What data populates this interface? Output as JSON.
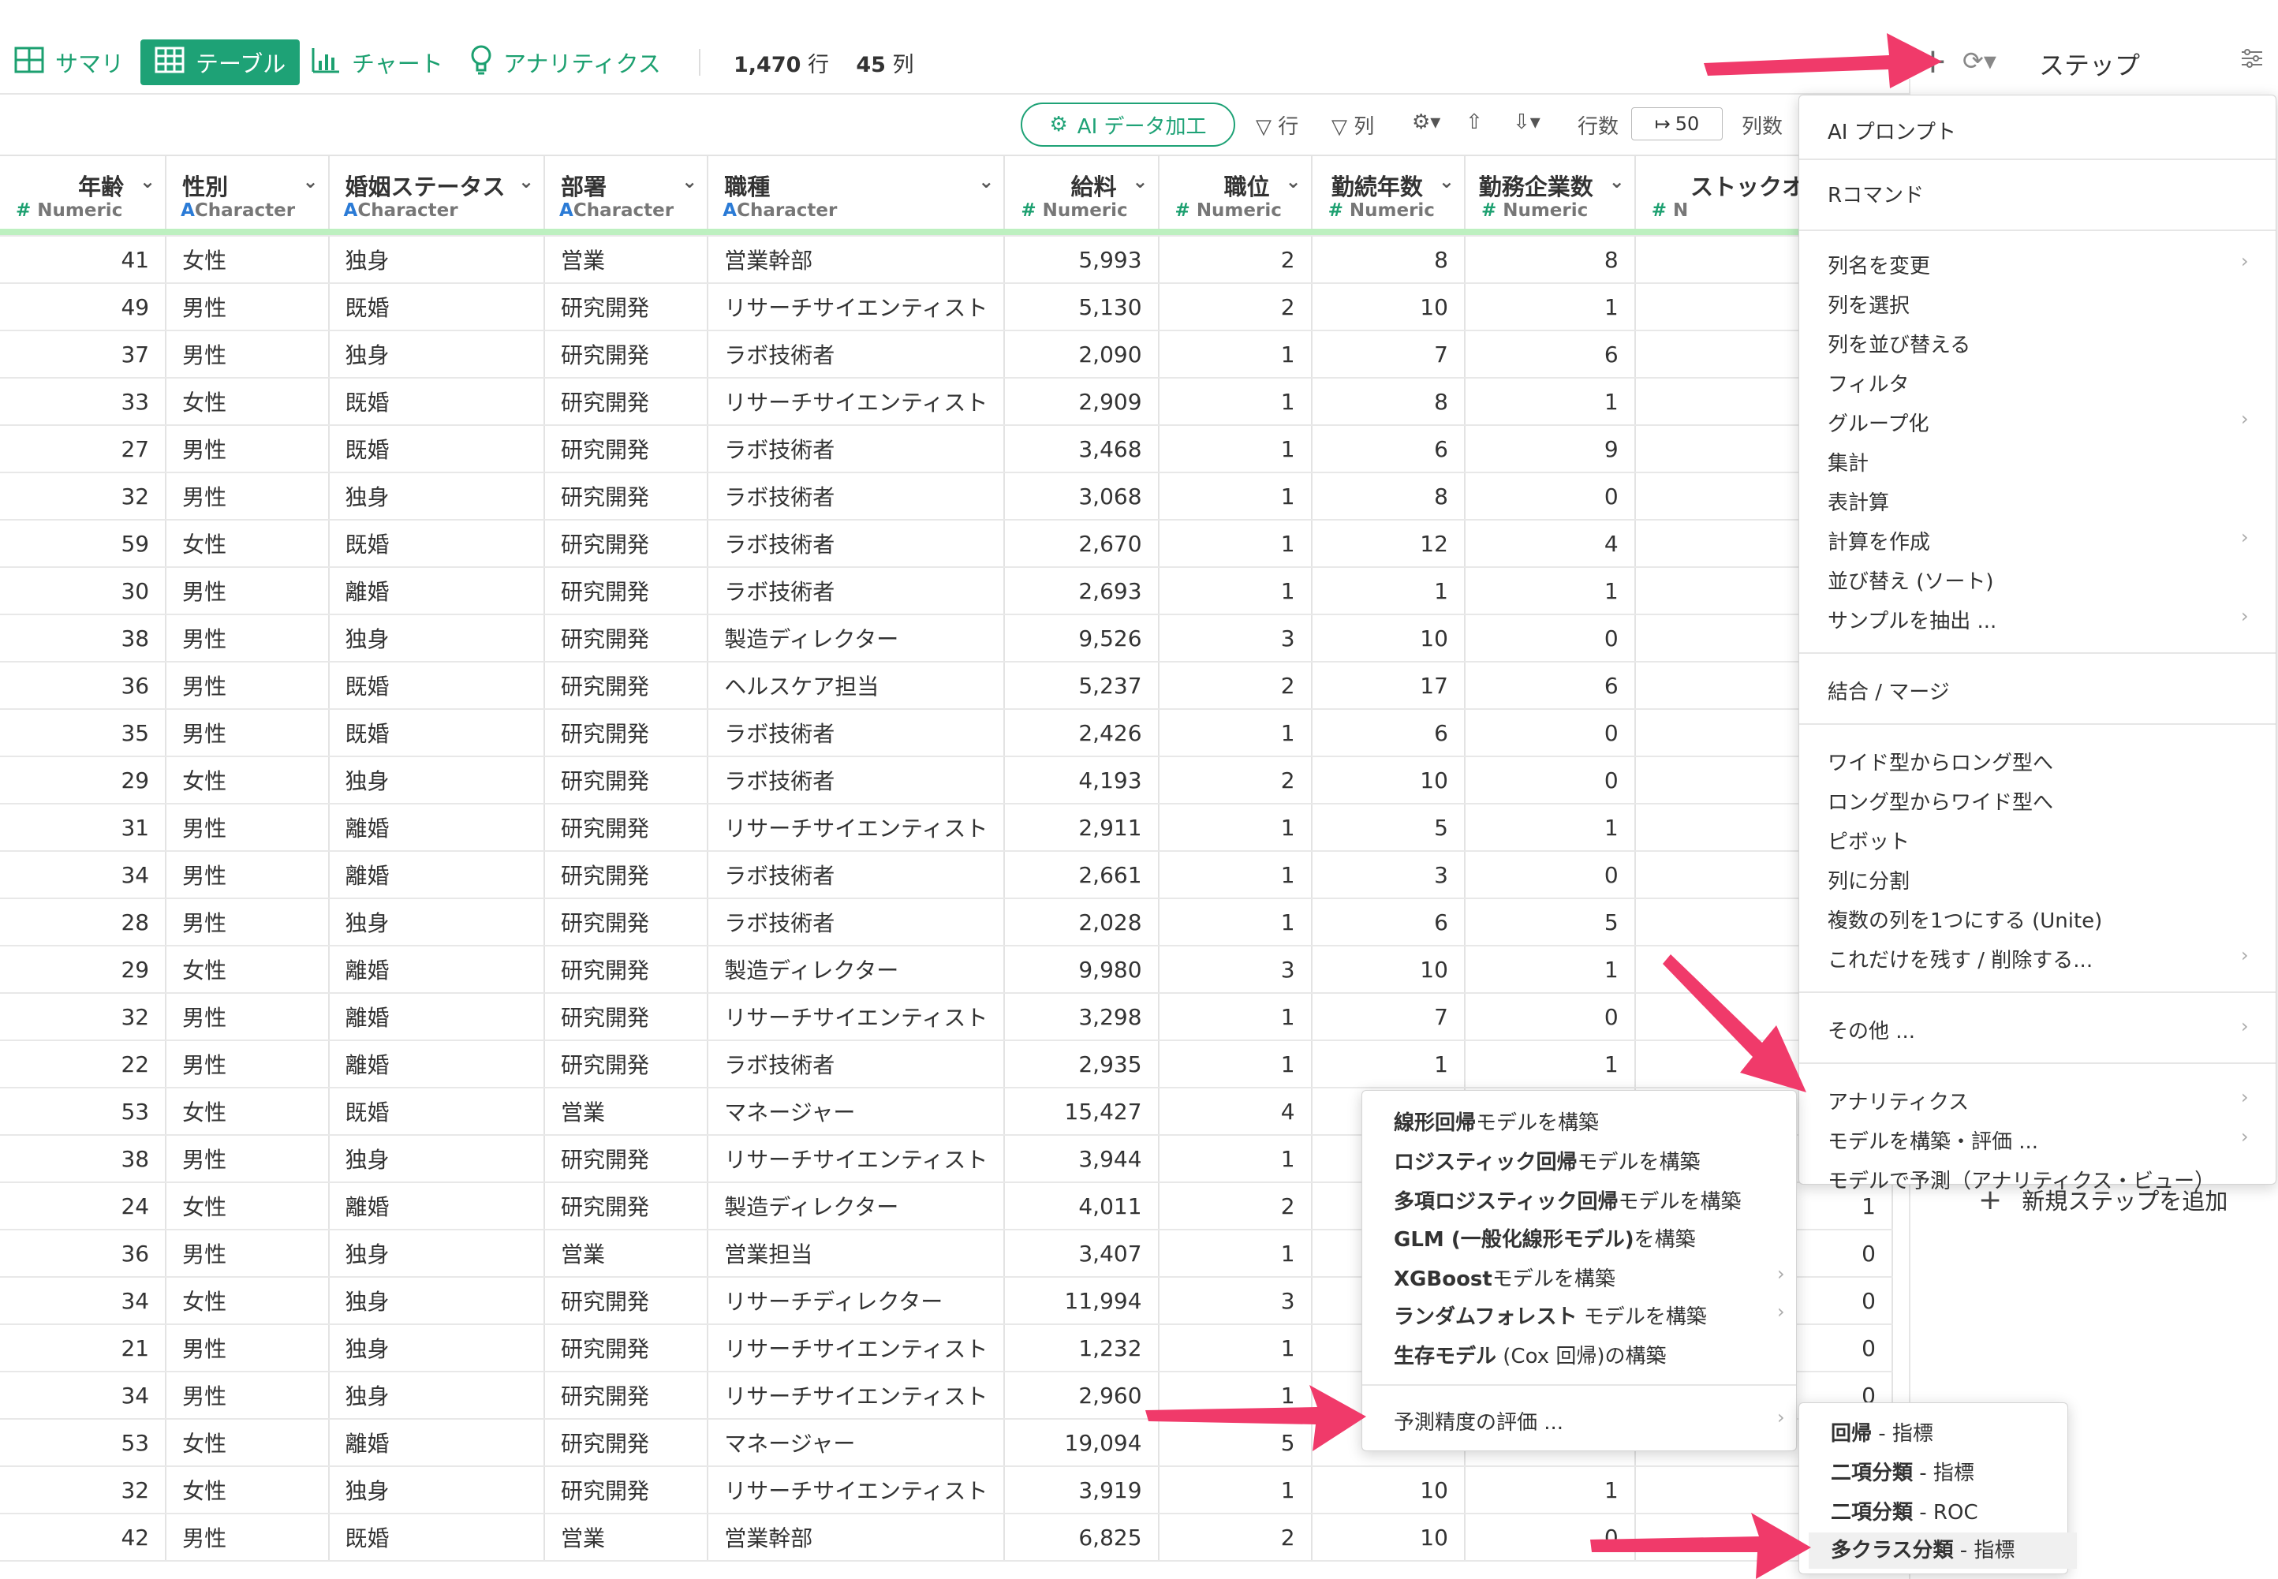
{
  "tabs": [
    {
      "label": "サマリ",
      "icon": "grid-icon"
    },
    {
      "label": "テーブル",
      "icon": "table-icon"
    },
    {
      "label": "チャート",
      "icon": "bar-chart-icon"
    },
    {
      "label": "アナリティクス",
      "icon": "lightbulb-icon"
    }
  ],
  "counts": {
    "rows": "1,470",
    "rows_unit": "行",
    "cols": "45",
    "cols_unit": "列"
  },
  "right_header": {
    "step_label": "ステップ"
  },
  "toolbar": {
    "ai_button": "AI データ加工",
    "row_filter": "行",
    "col_filter": "列",
    "rows_label": "行数",
    "rows_value": "50",
    "cols_label": "列数"
  },
  "columns": [
    {
      "name": "年齢",
      "type": "Numeric"
    },
    {
      "name": "性別",
      "type": "Character"
    },
    {
      "name": "婚姻ステータス",
      "type": "Character"
    },
    {
      "name": "部署",
      "type": "Character"
    },
    {
      "name": "職種",
      "type": "Character"
    },
    {
      "name": "給料",
      "type": "Numeric"
    },
    {
      "name": "職位",
      "type": "Numeric"
    },
    {
      "name": "勤続年数",
      "type": "Numeric"
    },
    {
      "name": "勤務企業数",
      "type": "Numeric"
    },
    {
      "name": "ストックオプシ",
      "type": "N"
    }
  ],
  "rows": [
    [
      "41",
      "女性",
      "独身",
      "営業",
      "営業幹部",
      "5,993",
      "2",
      "8",
      "8",
      ""
    ],
    [
      "49",
      "男性",
      "既婚",
      "研究開発",
      "リサーチサイエンティスト",
      "5,130",
      "2",
      "10",
      "1",
      ""
    ],
    [
      "37",
      "男性",
      "独身",
      "研究開発",
      "ラボ技術者",
      "2,090",
      "1",
      "7",
      "6",
      ""
    ],
    [
      "33",
      "女性",
      "既婚",
      "研究開発",
      "リサーチサイエンティスト",
      "2,909",
      "1",
      "8",
      "1",
      ""
    ],
    [
      "27",
      "男性",
      "既婚",
      "研究開発",
      "ラボ技術者",
      "3,468",
      "1",
      "6",
      "9",
      ""
    ],
    [
      "32",
      "男性",
      "独身",
      "研究開発",
      "ラボ技術者",
      "3,068",
      "1",
      "8",
      "0",
      ""
    ],
    [
      "59",
      "女性",
      "既婚",
      "研究開発",
      "ラボ技術者",
      "2,670",
      "1",
      "12",
      "4",
      ""
    ],
    [
      "30",
      "男性",
      "離婚",
      "研究開発",
      "ラボ技術者",
      "2,693",
      "1",
      "1",
      "1",
      ""
    ],
    [
      "38",
      "男性",
      "独身",
      "研究開発",
      "製造ディレクター",
      "9,526",
      "3",
      "10",
      "0",
      ""
    ],
    [
      "36",
      "男性",
      "既婚",
      "研究開発",
      "ヘルスケア担当",
      "5,237",
      "2",
      "17",
      "6",
      ""
    ],
    [
      "35",
      "男性",
      "既婚",
      "研究開発",
      "ラボ技術者",
      "2,426",
      "1",
      "6",
      "0",
      ""
    ],
    [
      "29",
      "女性",
      "独身",
      "研究開発",
      "ラボ技術者",
      "4,193",
      "2",
      "10",
      "0",
      ""
    ],
    [
      "31",
      "男性",
      "離婚",
      "研究開発",
      "リサーチサイエンティスト",
      "2,911",
      "1",
      "5",
      "1",
      ""
    ],
    [
      "34",
      "男性",
      "離婚",
      "研究開発",
      "ラボ技術者",
      "2,661",
      "1",
      "3",
      "0",
      ""
    ],
    [
      "28",
      "男性",
      "独身",
      "研究開発",
      "ラボ技術者",
      "2,028",
      "1",
      "6",
      "5",
      ""
    ],
    [
      "29",
      "女性",
      "離婚",
      "研究開発",
      "製造ディレクター",
      "9,980",
      "3",
      "10",
      "1",
      ""
    ],
    [
      "32",
      "男性",
      "離婚",
      "研究開発",
      "リサーチサイエンティスト",
      "3,298",
      "1",
      "7",
      "0",
      ""
    ],
    [
      "22",
      "男性",
      "離婚",
      "研究開発",
      "ラボ技術者",
      "2,935",
      "1",
      "1",
      "1",
      ""
    ],
    [
      "53",
      "女性",
      "既婚",
      "営業",
      "マネージャー",
      "15,427",
      "4",
      "",
      "",
      ""
    ],
    [
      "38",
      "男性",
      "独身",
      "研究開発",
      "リサーチサイエンティスト",
      "3,944",
      "1",
      "",
      "",
      ""
    ],
    [
      "24",
      "女性",
      "離婚",
      "研究開発",
      "製造ディレクター",
      "4,011",
      "2",
      "",
      "",
      "1"
    ],
    [
      "36",
      "男性",
      "独身",
      "営業",
      "営業担当",
      "3,407",
      "1",
      "",
      "",
      "0"
    ],
    [
      "34",
      "女性",
      "独身",
      "研究開発",
      "リサーチディレクター",
      "11,994",
      "3",
      "",
      "",
      "0"
    ],
    [
      "21",
      "男性",
      "独身",
      "研究開発",
      "リサーチサイエンティスト",
      "1,232",
      "1",
      "",
      "",
      "0"
    ],
    [
      "34",
      "男性",
      "独身",
      "研究開発",
      "リサーチサイエンティスト",
      "2,960",
      "1",
      "",
      "",
      "0"
    ],
    [
      "53",
      "女性",
      "離婚",
      "研究開発",
      "マネージャー",
      "19,094",
      "5",
      "",
      "",
      ""
    ],
    [
      "32",
      "女性",
      "独身",
      "研究開発",
      "リサーチサイエンティスト",
      "3,919",
      "1",
      "10",
      "1",
      ""
    ],
    [
      "42",
      "男性",
      "既婚",
      "営業",
      "営業幹部",
      "6,825",
      "2",
      "10",
      "0",
      ""
    ]
  ],
  "main_menu": [
    {
      "label": "AI プロンプト",
      "arrow": false
    },
    {
      "label": "Rコマンド",
      "arrow": false
    },
    {
      "label": "列名を変更",
      "arrow": true
    },
    {
      "label": "列を選択",
      "arrow": false
    },
    {
      "label": "列を並び替える",
      "arrow": false
    },
    {
      "label": "フィルタ",
      "arrow": false
    },
    {
      "label": "グループ化",
      "arrow": true
    },
    {
      "label": "集計",
      "arrow": false
    },
    {
      "label": "表計算",
      "arrow": false
    },
    {
      "label": "計算を作成",
      "arrow": true
    },
    {
      "label": "並び替え (ソート)",
      "arrow": false
    },
    {
      "label": "サンプルを抽出 ...",
      "arrow": true
    },
    {
      "label": "結合 / マージ",
      "arrow": false
    },
    {
      "label": "ワイド型からロング型へ",
      "arrow": false
    },
    {
      "label": "ロング型からワイド型へ",
      "arrow": false
    },
    {
      "label": "ピボット",
      "arrow": false
    },
    {
      "label": "列に分割",
      "arrow": false
    },
    {
      "label": "複数の列を1つにする (Unite)",
      "arrow": false
    },
    {
      "label": "これだけを残す / 削除する...",
      "arrow": true
    },
    {
      "label": "その他 ...",
      "arrow": true
    },
    {
      "label": "アナリティクス",
      "arrow": true
    },
    {
      "label": "モデルを構築・評価 ...",
      "arrow": true
    },
    {
      "label": "モデルで予測（アナリティクス・ビュー）",
      "arrow": false
    }
  ],
  "model_menu": [
    {
      "bold": "線形回帰",
      "rest": "モデルを構築",
      "arrow": false
    },
    {
      "bold": "ロジスティック回帰",
      "rest": "モデルを構築",
      "arrow": false
    },
    {
      "bold": "多項ロジスティック回帰",
      "rest": "モデルを構築",
      "arrow": false
    },
    {
      "bold": "GLM (一般化線形モデル)",
      "rest": "を構築",
      "arrow": false
    },
    {
      "bold": "XGBoost",
      "rest": "モデルを構築",
      "arrow": true
    },
    {
      "bold": "ランダムフォレスト",
      "rest": " モデルを構築",
      "arrow": true
    },
    {
      "bold": "生存モデル",
      "rest": " (Cox 回帰)の構築",
      "arrow": false
    },
    {
      "bold": "",
      "rest": "予測精度の評価 ...",
      "arrow": true
    }
  ],
  "eval_menu": [
    {
      "bold": "回帰",
      "rest": " - 指標"
    },
    {
      "bold": "二項分類",
      "rest": " - 指標"
    },
    {
      "bold": "二項分類",
      "rest": " - ROC"
    },
    {
      "bold": "多クラス分類",
      "rest": " - 指標"
    }
  ],
  "add_step_label": "新規ステップを追加",
  "colors": {
    "accent": "#1ea276",
    "arrow": "#f03a6a",
    "green_bar": "#bdf0c0"
  }
}
